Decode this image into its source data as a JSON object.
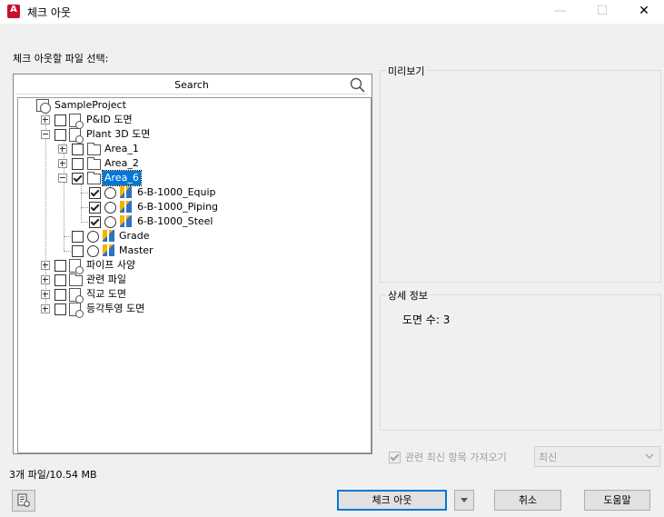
{
  "window": {
    "title": "체크 아웃",
    "app_icon_letter": "A",
    "minimize_glyph": "—",
    "maximize_glyph": "☐",
    "close_glyph": "✕"
  },
  "select_label": "체크 아웃할 파일 선택:",
  "search": {
    "placeholder": "Search"
  },
  "tree": {
    "root": "SampleProject",
    "pid": "P&ID 도면",
    "plant3d": "Plant 3D 도면",
    "area1": "Area_1",
    "area2": "Area_2",
    "area6": "Area_6",
    "equip": "6-B-1000_Equip",
    "piping": "6-B-1000_Piping",
    "steel": "6-B-1000_Steel",
    "grade": "Grade",
    "master": "Master",
    "pipespec": "파이프 사양",
    "related": "관련 파일",
    "ortho": "직교 도면",
    "iso": "등각투영 도면"
  },
  "status_text": "3개 파일/10.54 MB",
  "preview": {
    "title": "미리보기"
  },
  "details": {
    "title": "상세 정보",
    "drawing_count": "도면 수: 3"
  },
  "options": {
    "get_latest_label": "관련 최신 항목 가져오기",
    "get_latest_checked": true,
    "combo_value": "최신"
  },
  "buttons": {
    "checkout": "체크 아웃",
    "cancel": "취소",
    "help": "도움말"
  }
}
